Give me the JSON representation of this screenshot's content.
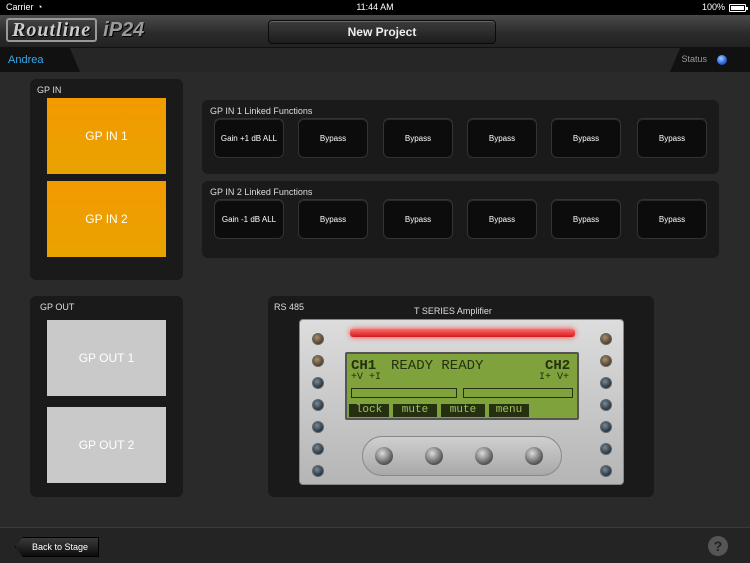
{
  "status_bar": {
    "carrier": "Carrier",
    "time": "11:44 AM",
    "battery": "100%"
  },
  "header": {
    "brand": "Routline",
    "model": "iP24",
    "project_title": "New Project"
  },
  "user_bar": {
    "user": "Andrea",
    "status_label": "Status"
  },
  "gp_in": {
    "title": "GP IN",
    "buttons": [
      "GP IN 1",
      "GP IN 2"
    ],
    "color": "#f39a00"
  },
  "linked": [
    {
      "title": "GP IN 1 Linked Functions",
      "buttons": [
        "Gain +1 dB ALL",
        "Bypass",
        "Bypass",
        "Bypass",
        "Bypass",
        "Bypass"
      ]
    },
    {
      "title": "GP IN 2 Linked Functions",
      "buttons": [
        "Gain -1 dB ALL",
        "Bypass",
        "Bypass",
        "Bypass",
        "Bypass",
        "Bypass"
      ]
    }
  ],
  "gp_out": {
    "title": "GP OUT",
    "buttons": [
      "GP OUT 1",
      "GP OUT 2"
    ],
    "color": "#c9c9c9"
  },
  "rs485": {
    "title": "RS 485",
    "device": "T SERIES Amplifier",
    "lcd": {
      "line1_left": "CH1",
      "line1_mid": "READY READY",
      "line1_right": "CH2",
      "line2_left": "+V +I",
      "line2_right": "I+ V+",
      "softkeys": [
        "lock",
        "mute",
        "mute",
        "menu"
      ]
    }
  },
  "footer": {
    "back_label": "Back to Stage",
    "help": "?"
  }
}
